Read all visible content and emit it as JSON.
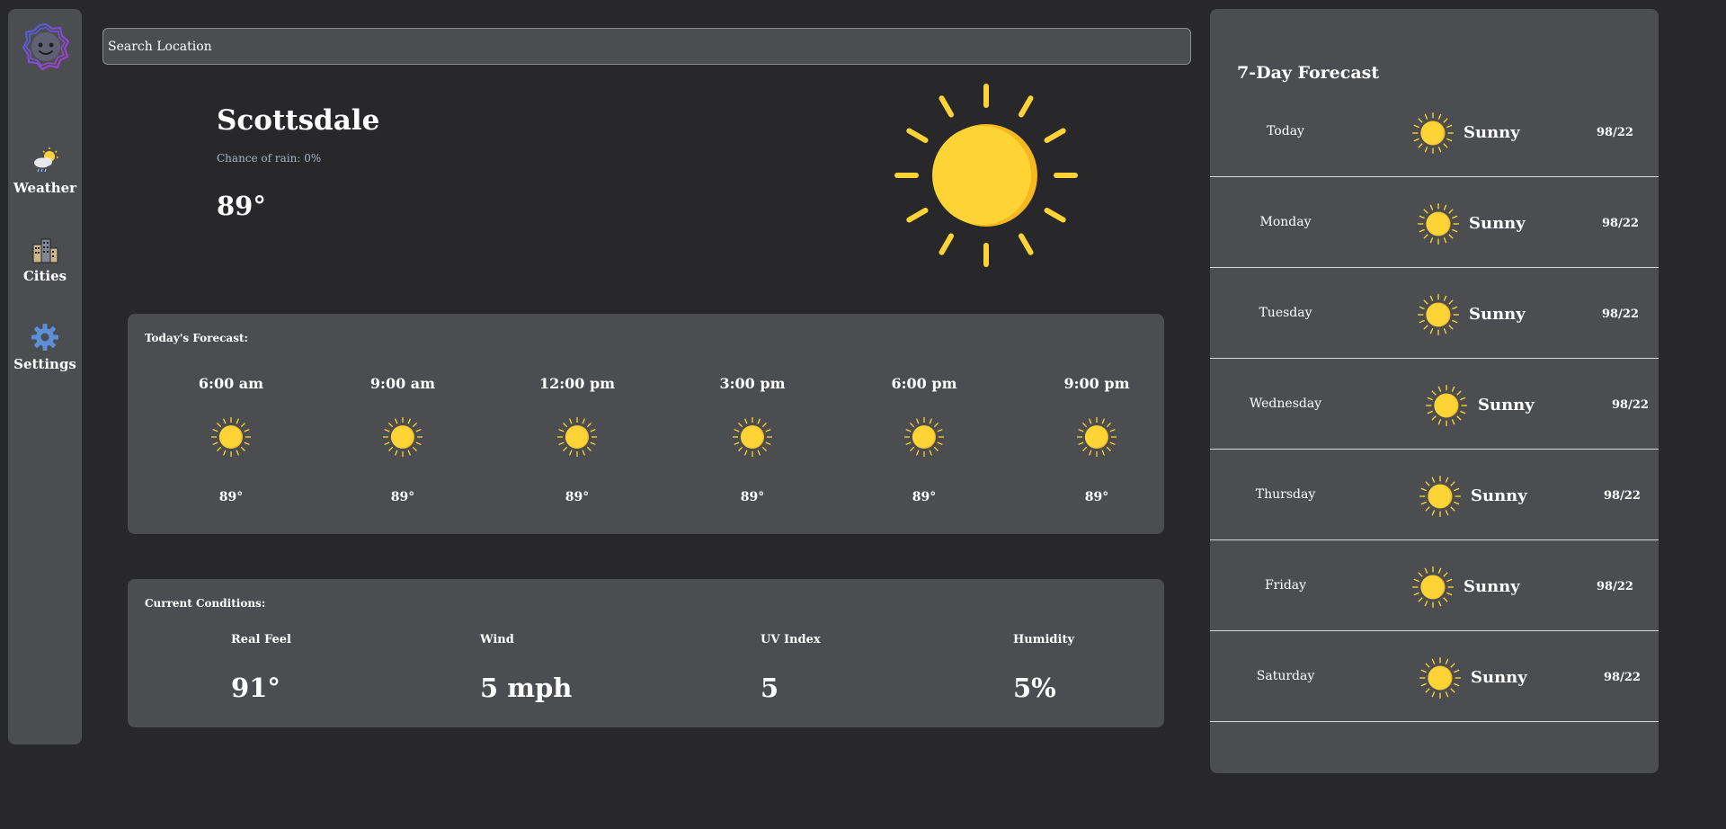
{
  "nav": [
    {
      "label": "Weather",
      "icon": "partly-cloudy-rain-icon"
    },
    {
      "label": "Cities",
      "icon": "city-buildings-icon"
    },
    {
      "label": "Settings",
      "icon": "gear-icon"
    }
  ],
  "search": {
    "placeholder": "Search Location"
  },
  "current": {
    "city": "Scottsdale",
    "rain": "Chance of rain: 0%",
    "temp": "89°",
    "icon": "sun-icon"
  },
  "today": {
    "title": "Today's Forecast:",
    "hours": [
      {
        "time": "6:00 am",
        "temp": "89°"
      },
      {
        "time": "9:00 am",
        "temp": "89°"
      },
      {
        "time": "12:00 pm",
        "temp": "89°"
      },
      {
        "time": "3:00 pm",
        "temp": "89°"
      },
      {
        "time": "6:00 pm",
        "temp": "89°"
      },
      {
        "time": "9:00 pm",
        "temp": "89°"
      }
    ]
  },
  "conditions": {
    "title": "Current Conditions:",
    "items": [
      {
        "label": "Real Feel",
        "value": "91°"
      },
      {
        "label": "Wind",
        "value": "5 mph"
      },
      {
        "label": "UV Index",
        "value": "5"
      },
      {
        "label": "Humidity",
        "value": "5%"
      }
    ]
  },
  "weekly": {
    "title": "7-Day Forecast",
    "days": [
      {
        "day": "Today",
        "cond": "Sunny",
        "temp": "98/22"
      },
      {
        "day": "Monday",
        "cond": "Sunny",
        "temp": "98/22"
      },
      {
        "day": "Tuesday",
        "cond": "Sunny",
        "temp": "98/22"
      },
      {
        "day": "Wednesday",
        "cond": "Sunny",
        "temp": "98/22"
      },
      {
        "day": "Thursday",
        "cond": "Sunny",
        "temp": "98/22"
      },
      {
        "day": "Friday",
        "cond": "Sunny",
        "temp": "98/22"
      },
      {
        "day": "Saturday",
        "cond": "Sunny",
        "temp": "98/22"
      }
    ]
  },
  "colors": {
    "sun": "#fdd335",
    "sun_shadow": "#f6b81e",
    "panel": "#4c4d50",
    "background": "#28282a"
  }
}
